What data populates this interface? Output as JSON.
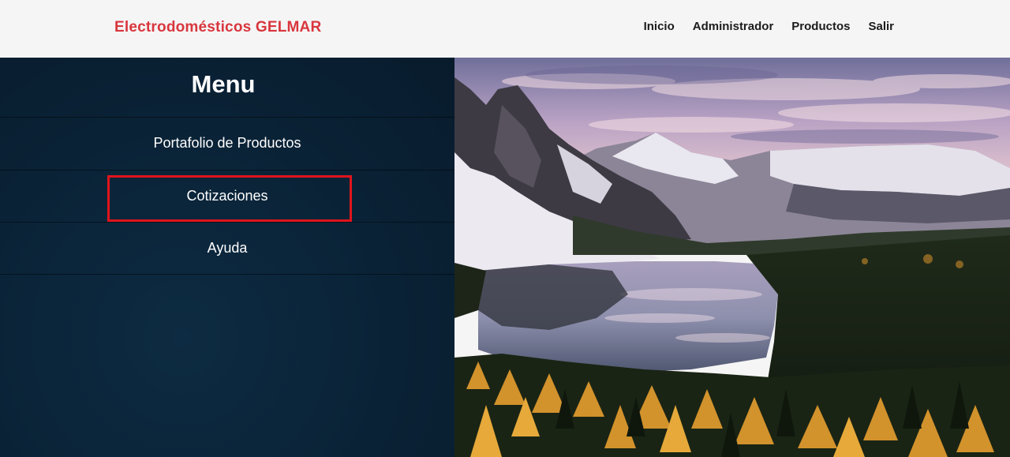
{
  "navbar": {
    "brand": "Electrodomésticos GELMAR",
    "links": [
      {
        "label": "Inicio"
      },
      {
        "label": "Administrador"
      },
      {
        "label": "Productos"
      },
      {
        "label": "Salir"
      }
    ]
  },
  "menu": {
    "title": "Menu",
    "items": [
      {
        "label": "Portafolio de Productos"
      },
      {
        "label": "Cotizaciones",
        "highlighted": true
      },
      {
        "label": "Ayuda"
      }
    ]
  },
  "colors": {
    "brand": "#d9363e",
    "menu_background": "#0a2236",
    "highlight_border": "#e0141c"
  },
  "hero_image": {
    "subject": "mountain-lake-landscape"
  }
}
